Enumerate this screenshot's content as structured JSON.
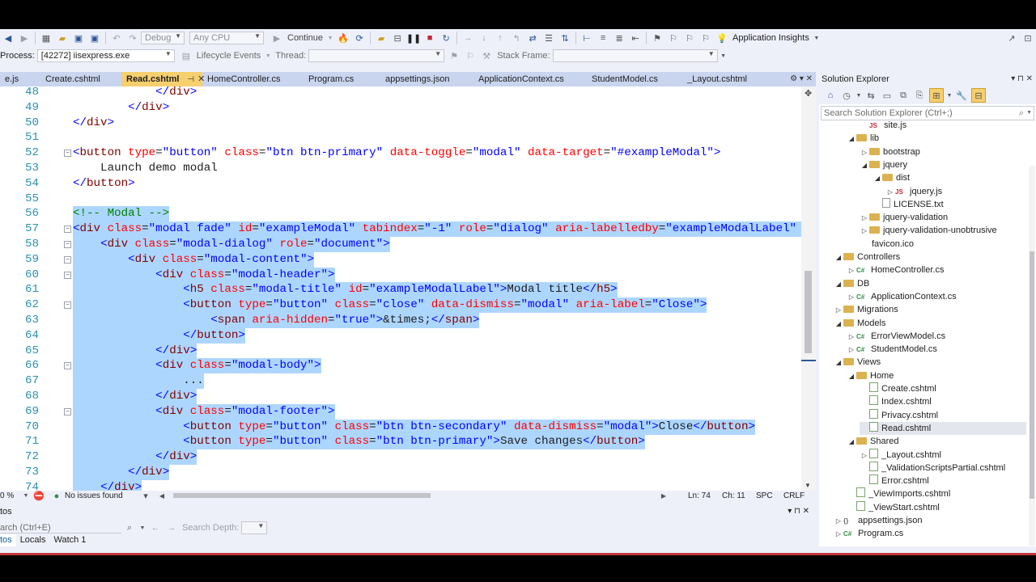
{
  "toolbar": {
    "config": "Debug",
    "platform": "Any CPU",
    "continue_label": "Continue",
    "app_insights": "Application Insights",
    "process_label": "Process:",
    "process_value": "[42272] iisexpress.exe",
    "lifecycle_label": "Lifecycle Events",
    "thread_label": "Thread:",
    "stackframe_label": "Stack Frame:"
  },
  "tabs": [
    {
      "label": "e.js",
      "active": false
    },
    {
      "label": "Create.cshtml",
      "active": false
    },
    {
      "label": "Read.cshtml",
      "active": true
    },
    {
      "label": "HomeController.cs",
      "active": false
    },
    {
      "label": "Program.cs",
      "active": false
    },
    {
      "label": "appsettings.json",
      "active": false
    },
    {
      "label": "ApplicationContext.cs",
      "active": false
    },
    {
      "label": "StudentModel.cs",
      "active": false
    },
    {
      "label": "_Layout.cshtml",
      "active": false
    }
  ],
  "editor": {
    "lines": [
      {
        "n": "48",
        "text": "            </div>",
        "fold": false,
        "sel": false
      },
      {
        "n": "49",
        "text": "        </div>",
        "fold": false,
        "sel": false
      },
      {
        "n": "50",
        "text": "</div>",
        "fold": false,
        "sel": false
      },
      {
        "n": "51",
        "text": "",
        "fold": false,
        "sel": false
      },
      {
        "n": "52",
        "text": "<button type=\"button\" class=\"btn btn-primary\" data-toggle=\"modal\" data-target=\"#exampleModal\">",
        "fold": true,
        "sel": false
      },
      {
        "n": "53",
        "text": "    Launch demo modal",
        "fold": false,
        "sel": false
      },
      {
        "n": "54",
        "text": "</button>",
        "fold": false,
        "sel": false
      },
      {
        "n": "55",
        "text": "",
        "fold": false,
        "sel": false
      },
      {
        "n": "56",
        "text": "<!-- Modal -->",
        "fold": false,
        "sel": true
      },
      {
        "n": "57",
        "text": "<div class=\"modal fade\" id=\"exampleModal\" tabindex=\"-1\" role=\"dialog\" aria-labelledby=\"exampleModalLabel\" a",
        "fold": true,
        "sel": true
      },
      {
        "n": "58",
        "text": "    <div class=\"modal-dialog\" role=\"document\">",
        "fold": true,
        "sel": true
      },
      {
        "n": "59",
        "text": "        <div class=\"modal-content\">",
        "fold": true,
        "sel": true
      },
      {
        "n": "60",
        "text": "            <div class=\"modal-header\">",
        "fold": true,
        "sel": true
      },
      {
        "n": "61",
        "text": "                <h5 class=\"modal-title\" id=\"exampleModalLabel\">Modal title</h5>",
        "fold": false,
        "sel": true
      },
      {
        "n": "62",
        "text": "                <button type=\"button\" class=\"close\" data-dismiss=\"modal\" aria-label=\"Close\">",
        "fold": true,
        "sel": true
      },
      {
        "n": "63",
        "text": "                    <span aria-hidden=\"true\">&times;</span>",
        "fold": false,
        "sel": true
      },
      {
        "n": "64",
        "text": "                </button>",
        "fold": false,
        "sel": true
      },
      {
        "n": "65",
        "text": "            </div>",
        "fold": false,
        "sel": true
      },
      {
        "n": "66",
        "text": "            <div class=\"modal-body\">",
        "fold": true,
        "sel": true
      },
      {
        "n": "67",
        "text": "                ...",
        "fold": false,
        "sel": true
      },
      {
        "n": "68",
        "text": "            </div>",
        "fold": false,
        "sel": true
      },
      {
        "n": "69",
        "text": "            <div class=\"modal-footer\">",
        "fold": true,
        "sel": true
      },
      {
        "n": "70",
        "text": "                <button type=\"button\" class=\"btn btn-secondary\" data-dismiss=\"modal\">Close</button>",
        "fold": false,
        "sel": true
      },
      {
        "n": "71",
        "text": "                <button type=\"button\" class=\"btn btn-primary\">Save changes</button>",
        "fold": false,
        "sel": true
      },
      {
        "n": "72",
        "text": "            </div>",
        "fold": false,
        "sel": true
      },
      {
        "n": "73",
        "text": "        </div>",
        "fold": false,
        "sel": true
      },
      {
        "n": "74",
        "text": "    </div>",
        "fold": false,
        "sel": true
      }
    ]
  },
  "status": {
    "zoom": "0 %",
    "issues": "No issues found",
    "ln": "Ln: 74",
    "ch": "Ch: 11",
    "spc": "SPC",
    "crlf": "CRLF"
  },
  "autos": {
    "title": "tos",
    "search_placeholder": "arch (Ctrl+E)",
    "search_depth": "Search Depth:",
    "tabs": [
      "tos",
      "Locals",
      "Watch 1"
    ]
  },
  "solution_explorer": {
    "title": "Solution Explorer",
    "search_placeholder": "Search Solution Explorer (Ctrl+;)",
    "items": [
      {
        "label": "site.js",
        "indent": 4,
        "arrow": "",
        "icon": "js",
        "selected": false
      },
      {
        "label": "lib",
        "indent": 3,
        "arrow": "◢",
        "icon": "folder",
        "selected": false
      },
      {
        "label": "bootstrap",
        "indent": 4,
        "arrow": "▷",
        "icon": "folder",
        "selected": false
      },
      {
        "label": "jquery",
        "indent": 4,
        "arrow": "◢",
        "icon": "folder",
        "selected": false
      },
      {
        "label": "dist",
        "indent": 5,
        "arrow": "◢",
        "icon": "folder",
        "selected": false
      },
      {
        "label": "jquery.js",
        "indent": 6,
        "arrow": "▷",
        "icon": "js",
        "selected": false
      },
      {
        "label": "LICENSE.txt",
        "indent": 5,
        "arrow": "",
        "icon": "txt",
        "selected": false
      },
      {
        "label": "jquery-validation",
        "indent": 4,
        "arrow": "▷",
        "icon": "folder",
        "selected": false
      },
      {
        "label": "jquery-validation-unobtrusive",
        "indent": 4,
        "arrow": "▷",
        "icon": "folder",
        "selected": false
      },
      {
        "label": "favicon.ico",
        "indent": 3,
        "arrow": "",
        "icon": "ico",
        "selected": false
      },
      {
        "label": "Controllers",
        "indent": 2,
        "arrow": "◢",
        "icon": "folder",
        "selected": false
      },
      {
        "label": "HomeController.cs",
        "indent": 3,
        "arrow": "▷",
        "icon": "cs",
        "selected": false
      },
      {
        "label": "DB",
        "indent": 2,
        "arrow": "◢",
        "icon": "folder",
        "selected": false
      },
      {
        "label": "ApplicationContext.cs",
        "indent": 3,
        "arrow": "▷",
        "icon": "cs",
        "selected": false
      },
      {
        "label": "Migrations",
        "indent": 2,
        "arrow": "▷",
        "icon": "folder",
        "selected": false
      },
      {
        "label": "Models",
        "indent": 2,
        "arrow": "◢",
        "icon": "folder",
        "selected": false
      },
      {
        "label": "ErrorViewModel.cs",
        "indent": 3,
        "arrow": "▷",
        "icon": "cs",
        "selected": false
      },
      {
        "label": "StudentModel.cs",
        "indent": 3,
        "arrow": "▷",
        "icon": "cs",
        "selected": false
      },
      {
        "label": "Views",
        "indent": 2,
        "arrow": "◢",
        "icon": "folder",
        "selected": false
      },
      {
        "label": "Home",
        "indent": 3,
        "arrow": "◢",
        "icon": "folder",
        "selected": false
      },
      {
        "label": "Create.cshtml",
        "indent": 4,
        "arrow": "",
        "icon": "html",
        "selected": false
      },
      {
        "label": "Index.cshtml",
        "indent": 4,
        "arrow": "",
        "icon": "html",
        "selected": false
      },
      {
        "label": "Privacy.cshtml",
        "indent": 4,
        "arrow": "",
        "icon": "html",
        "selected": false
      },
      {
        "label": "Read.cshtml",
        "indent": 4,
        "arrow": "",
        "icon": "html",
        "selected": true
      },
      {
        "label": "Shared",
        "indent": 3,
        "arrow": "◢",
        "icon": "folder",
        "selected": false
      },
      {
        "label": "_Layout.cshtml",
        "indent": 4,
        "arrow": "▷",
        "icon": "html",
        "selected": false
      },
      {
        "label": "_ValidationScriptsPartial.cshtml",
        "indent": 4,
        "arrow": "",
        "icon": "html",
        "selected": false
      },
      {
        "label": "Error.cshtml",
        "indent": 4,
        "arrow": "",
        "icon": "html",
        "selected": false
      },
      {
        "label": "_ViewImports.cshtml",
        "indent": 3,
        "arrow": "",
        "icon": "html",
        "selected": false
      },
      {
        "label": "_ViewStart.cshtml",
        "indent": 3,
        "arrow": "",
        "icon": "html",
        "selected": false
      },
      {
        "label": "appsettings.json",
        "indent": 2,
        "arrow": "▷",
        "icon": "json",
        "selected": false
      },
      {
        "label": "Program.cs",
        "indent": 2,
        "arrow": "▷",
        "icon": "cs",
        "selected": false
      }
    ]
  }
}
